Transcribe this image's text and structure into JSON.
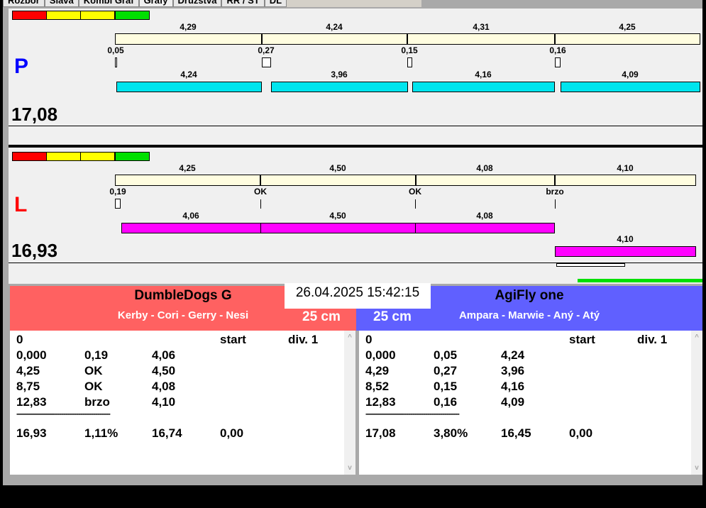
{
  "tabs": [
    "Rozbor",
    "Sláva",
    "Kombi Graf",
    "Grafy",
    "Družstva",
    "RR / ST",
    "DL"
  ],
  "colors": {
    "red": "#ff0000",
    "yellow": "#ffff00",
    "green": "#00e000",
    "cyan": "#00e5ee",
    "magenta": "#ff00ff",
    "team_red": "#ff6161",
    "team_blue": "#6060ff"
  },
  "p": {
    "letter": "P",
    "total": "17,08",
    "splits": [
      "4,29",
      "4,24",
      "4,31",
      "4,25"
    ],
    "reactions": [
      "0,05",
      "0,27",
      "0,15",
      "0,16"
    ],
    "runs": [
      "4,24",
      "3,96",
      "4,16",
      "4,09"
    ]
  },
  "l": {
    "letter": "L",
    "total": "16,93",
    "splits": [
      "4,25",
      "4,50",
      "4,08",
      "4,10"
    ],
    "reactions": [
      "0,19",
      "OK",
      "OK",
      "brzo"
    ],
    "runs": [
      "4,06",
      "4,50",
      "4,08",
      "4,10"
    ]
  },
  "datetime": "26.04.2025 15:42:15",
  "left_team": {
    "name": "DumbleDogs G",
    "dogs": "Kerby - Cori - Gerry - Nesi",
    "height": "25 cm",
    "header": [
      "0",
      "start",
      "div. 1"
    ],
    "rows": [
      [
        "0,000",
        "0,19",
        "4,06"
      ],
      [
        "4,25",
        "OK",
        "4,50"
      ],
      [
        "8,75",
        "OK",
        "4,08"
      ],
      [
        "12,83",
        "brzo",
        "4,10"
      ]
    ],
    "separator": "--------------------------------------------",
    "summary": [
      "16,93",
      "1,11%",
      "16,74",
      "0,00"
    ]
  },
  "right_team": {
    "name": "AgiFly one",
    "dogs": "Ampara - Marwie - Aný - Atý",
    "height": "25 cm",
    "header": [
      "0",
      "start",
      "div. 1"
    ],
    "rows": [
      [
        "0,000",
        "0,05",
        "4,24"
      ],
      [
        "4,29",
        "0,27",
        "3,96"
      ],
      [
        "8,52",
        "0,15",
        "4,16"
      ],
      [
        "12,83",
        "0,16",
        "4,09"
      ]
    ],
    "separator": "--------------------------------------------",
    "summary": [
      "17,08",
      "3,80%",
      "16,45",
      "0,00"
    ]
  }
}
